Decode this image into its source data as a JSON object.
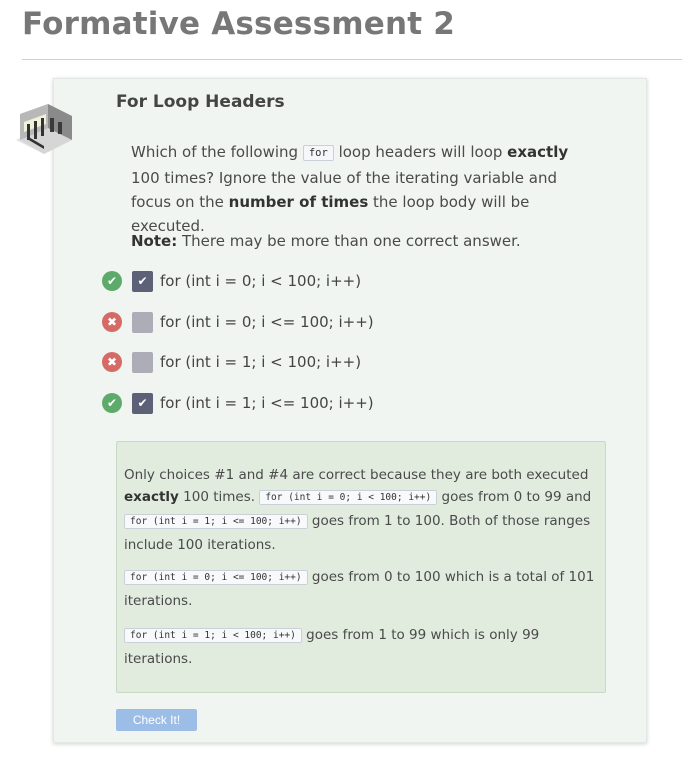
{
  "page": {
    "title": "Formative Assessment 2"
  },
  "card": {
    "heading": "For Loop Headers",
    "question": {
      "part1": "Which of the following ",
      "code": "for",
      "part2": " loop headers will loop ",
      "bold1": "exactly",
      "part3": " 100 times? Ignore the value of the iterating variable and focus on the ",
      "bold2": "number of times",
      "part4": " the loop body will be executed."
    },
    "note": {
      "label": "Note:",
      "text": " There may be more than one correct answer."
    },
    "choices": [
      {
        "label": "for (int i = 0; i < 100; i++)",
        "status": "correct",
        "status_icon": "check-icon",
        "checked": true,
        "check_glyph": "✔"
      },
      {
        "label": "for (int i = 0; i <= 100; i++)",
        "status": "incorrect",
        "status_icon": "x-icon",
        "checked": false,
        "check_glyph": ""
      },
      {
        "label": "for (int i = 1; i < 100; i++)",
        "status": "incorrect",
        "status_icon": "x-icon",
        "checked": false,
        "check_glyph": ""
      },
      {
        "label": "for (int i = 1; i <= 100; i++)",
        "status": "correct",
        "status_icon": "check-icon",
        "checked": true,
        "check_glyph": "✔"
      }
    ],
    "feedback": {
      "p1": {
        "a": "Only choices #1 and #4 are correct because they are both executed ",
        "b": "exactly",
        "c": " 100 times. ",
        "code1": "for (int i = 0; i < 100; i++)",
        "d": " goes from 0 to 99 and ",
        "code2": "for (int i = 1; i <= 100; i++)",
        "e": " goes from 1 to 100. Both of those ranges include 100 iterations."
      },
      "p2": {
        "code": "for (int i = 0; i <= 100; i++)",
        "text": " goes from 0 to 100 which is a total of 101 iterations."
      },
      "p3": {
        "code": "for (int i = 1; i < 100; i++)",
        "text": " goes from 1 to 99 which is only 99 iterations."
      }
    },
    "button": {
      "label": "Check It!"
    }
  },
  "colors": {
    "correct": "#5eaa6b",
    "incorrect": "#d66a66",
    "checked_box": "#5c6178",
    "unchecked_box": "#adadb8",
    "feedback_bg": "#e1ecdf",
    "button_bg": "#9cbde6"
  }
}
